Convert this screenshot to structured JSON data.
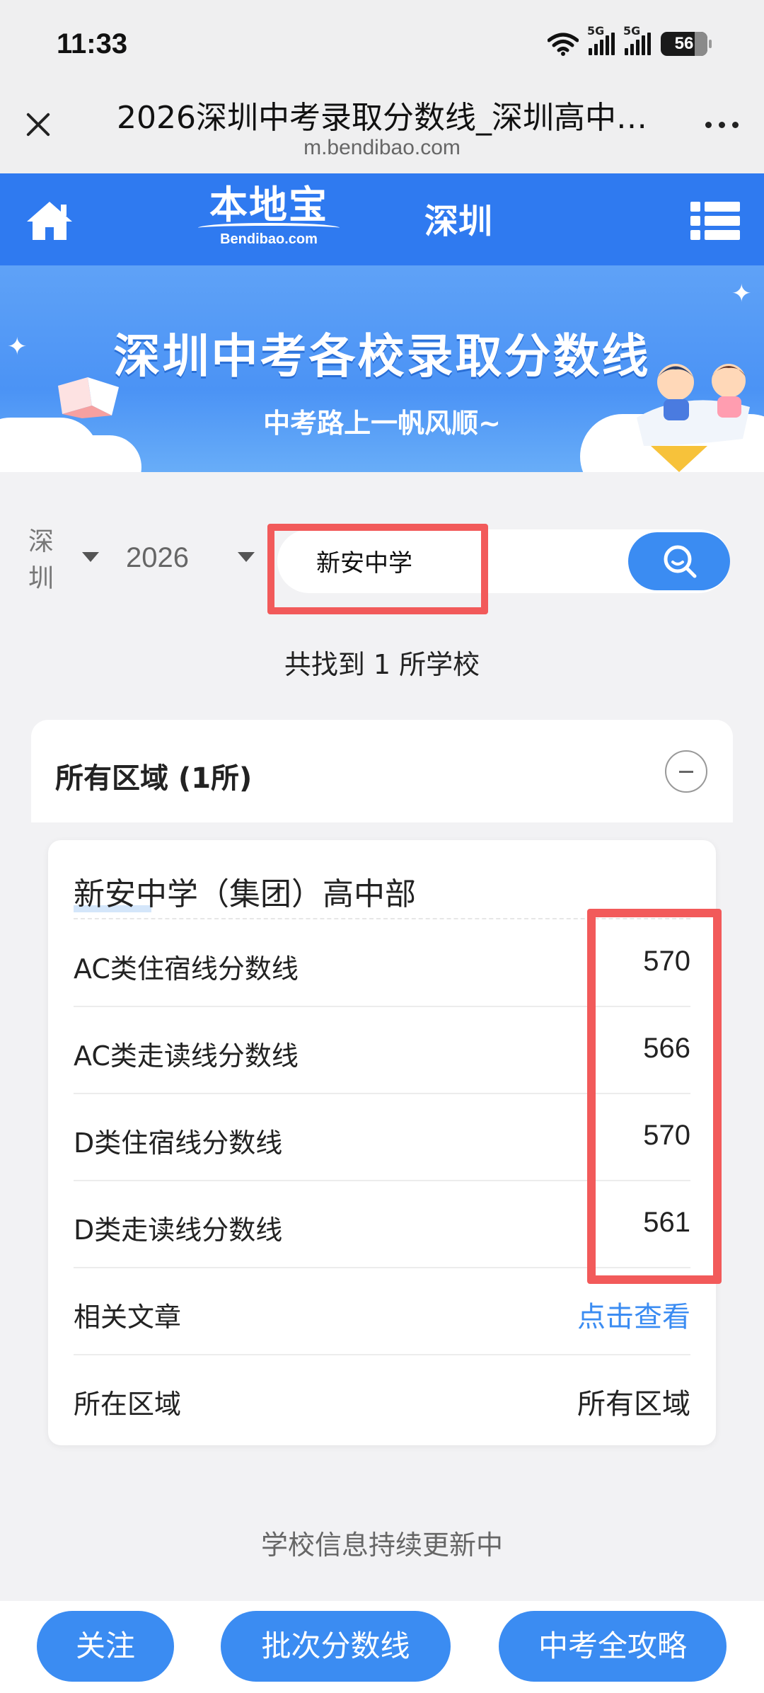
{
  "status_bar": {
    "time": "11:33",
    "signal_labels": [
      "5G",
      "5G"
    ],
    "battery": "56"
  },
  "browser": {
    "title": "2026深圳中考录取分数线_深圳高中…",
    "url": "m.bendibao.com"
  },
  "site_header": {
    "logo_main": "本地宝",
    "logo_sub": "Bendibao.com",
    "city": "深圳"
  },
  "banner": {
    "title": "深圳中考各校录取分数线",
    "subtitle": "中考路上一帆风顺~"
  },
  "filters": {
    "city": "深圳",
    "year": "2026",
    "search_value": "新安中学"
  },
  "result_count": "共找到 1 所学校",
  "region_panel": {
    "title": "所有区域 (1所)"
  },
  "school": {
    "name": "新安中学（集团）高中部",
    "rows": [
      {
        "label": "AC类住宿线分数线",
        "value": "570"
      },
      {
        "label": "AC类走读线分数线",
        "value": "566"
      },
      {
        "label": "D类住宿线分数线",
        "value": "570"
      },
      {
        "label": "D类走读线分数线",
        "value": "561"
      },
      {
        "label": "相关文章",
        "value": "点击查看"
      },
      {
        "label": "所在区域",
        "value": "所有区域"
      }
    ]
  },
  "updating_note": "学校信息持续更新中",
  "bottom_buttons": {
    "follow": "关注",
    "batch": "批次分数线",
    "guide": "中考全攻略"
  },
  "colors": {
    "brand_blue": "#2f7af0",
    "button_blue": "#3b8cf2",
    "highlight_red": "#f25a5a"
  }
}
